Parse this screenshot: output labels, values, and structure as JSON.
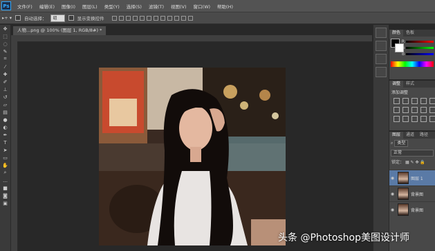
{
  "app": {
    "logo": "Ps"
  },
  "menu": [
    "文件(F)",
    "编辑(E)",
    "图像(I)",
    "图层(L)",
    "类型(Y)",
    "选择(S)",
    "滤镜(T)",
    "视图(V)",
    "窗口(W)",
    "帮助(H)"
  ],
  "options": {
    "auto_select_label": "自动选择：",
    "auto_select_value": "组",
    "transform_controls_label": "显示变换控件"
  },
  "document": {
    "tab_title": "人物...png @ 100% (图层 1, RGB/8#) *"
  },
  "color_panel": {
    "tabs": [
      "颜色",
      "色板"
    ],
    "channels": [
      "R",
      "G",
      "B"
    ],
    "foreground": "#000000",
    "background": "#ffffff"
  },
  "adjust_panel": {
    "tabs": [
      "调整",
      "样式"
    ],
    "title": "添加调整"
  },
  "layers_panel": {
    "tabs": [
      "图层",
      "通道",
      "路径"
    ],
    "kind_filter": "类型",
    "blend_mode": "正常",
    "lock_label": "锁定：",
    "layers": [
      {
        "name": "图层 1",
        "selected": true
      },
      {
        "name": "背景图",
        "selected": false
      },
      {
        "name": "背景图",
        "selected": false
      }
    ]
  },
  "watermark": "头条 @Photoshop美图设计师"
}
